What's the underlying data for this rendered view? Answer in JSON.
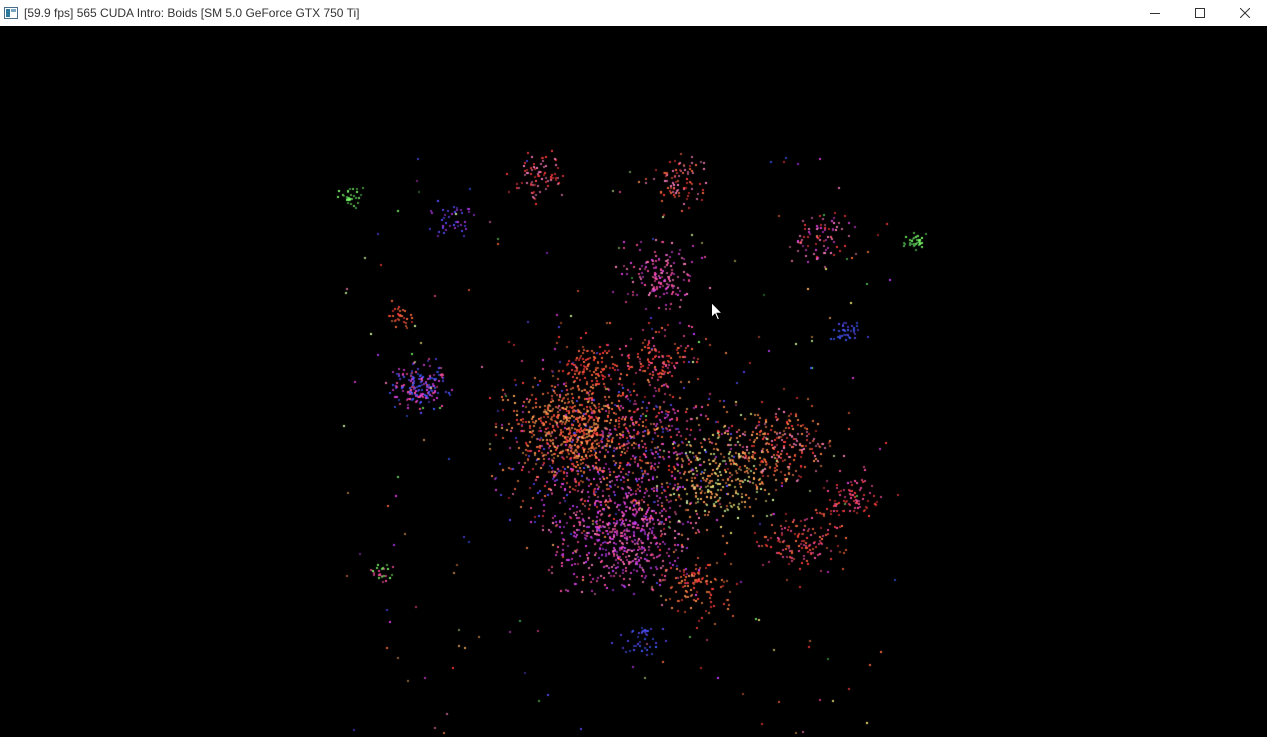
{
  "window": {
    "title": "[59.9 fps] 565 CUDA Intro: Boids [SM 5.0 GeForce GTX 750 Ti]",
    "controls": {
      "minimize_icon": "minimize-icon",
      "maximize_icon": "maximize-icon",
      "close_icon": "close-icon"
    }
  },
  "scene": {
    "background": "#000000",
    "palette": [
      "#ff3b3b",
      "#ff6a3d",
      "#ff8c4a",
      "#ff4fa0",
      "#e040e0",
      "#c23cff",
      "#5a4cff",
      "#3d5bff",
      "#ffb060",
      "#f0e070",
      "#7dff6a",
      "#4caf50",
      "#ff7fbf",
      "#d4ffa0"
    ]
  }
}
